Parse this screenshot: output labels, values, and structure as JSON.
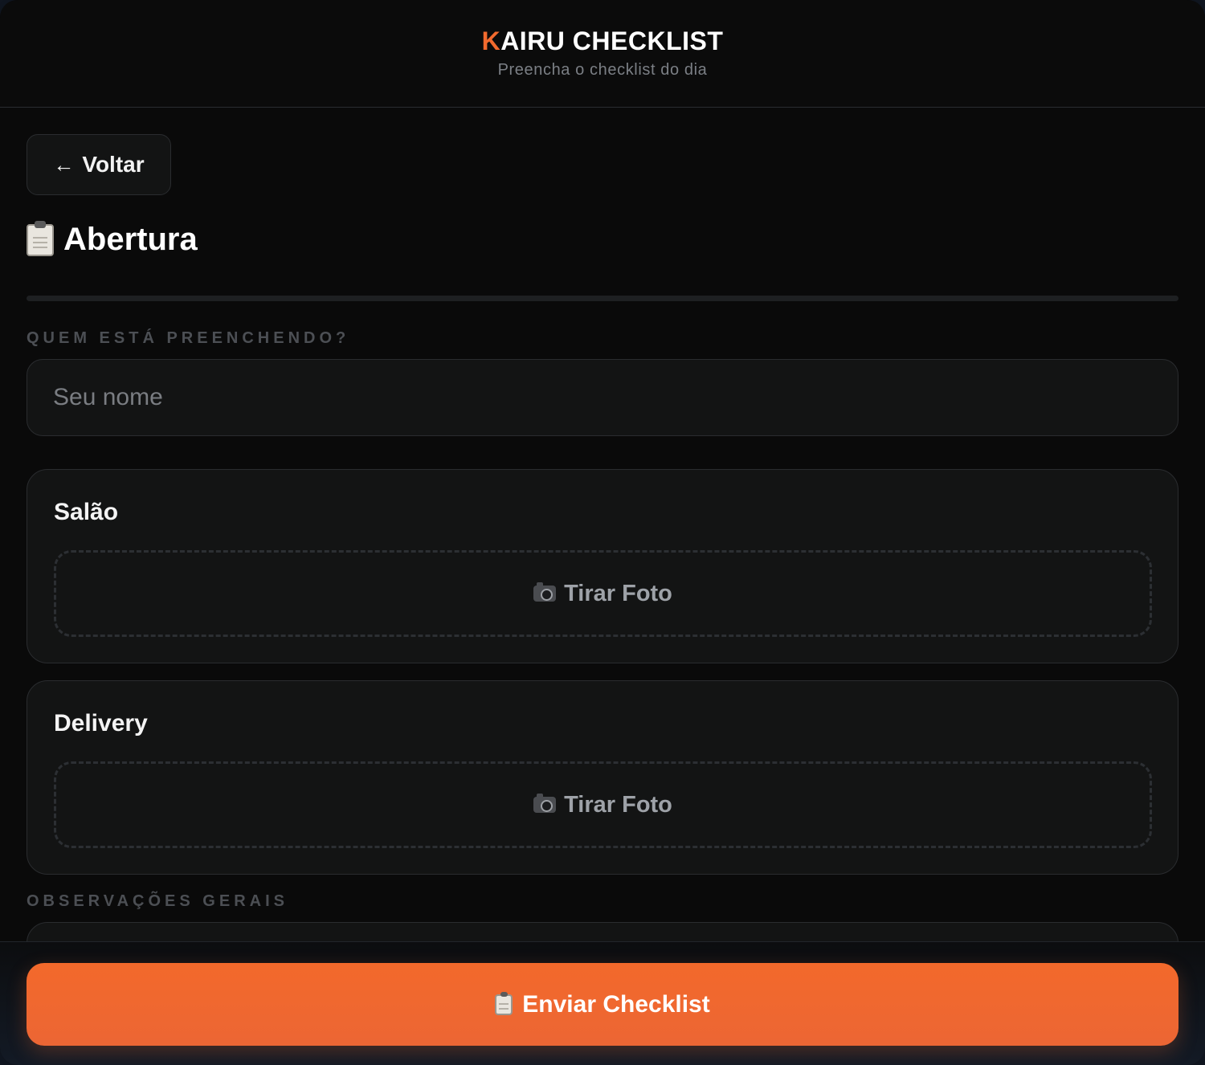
{
  "header": {
    "brand_first_letter": "K",
    "brand_rest": "AIRU CHECKLIST",
    "subtitle": "Preencha o checklist do dia"
  },
  "nav": {
    "back_label": "Voltar",
    "back_icon": "arrow-left-icon"
  },
  "page": {
    "title": "Abertura",
    "title_icon": "clipboard-icon"
  },
  "form": {
    "name_label": "QUEM ESTÁ PREENCHENDO?",
    "name_placeholder": "Seu nome",
    "name_value": "",
    "sections": [
      {
        "title": "Salão",
        "photo_label": "Tirar Foto",
        "photo_icon": "camera-icon"
      },
      {
        "title": "Delivery",
        "photo_label": "Tirar Foto",
        "photo_icon": "camera-icon"
      }
    ],
    "observations_label": "OBSERVAÇÕES GERAIS"
  },
  "footer": {
    "submit_label": "Enviar Checklist",
    "submit_icon": "clipboard-icon"
  },
  "colors": {
    "accent": "#f26a2e",
    "background": "#0a0a0a",
    "card": "#131414",
    "border": "#2a2c2f",
    "muted_label": "#4c4f54"
  }
}
